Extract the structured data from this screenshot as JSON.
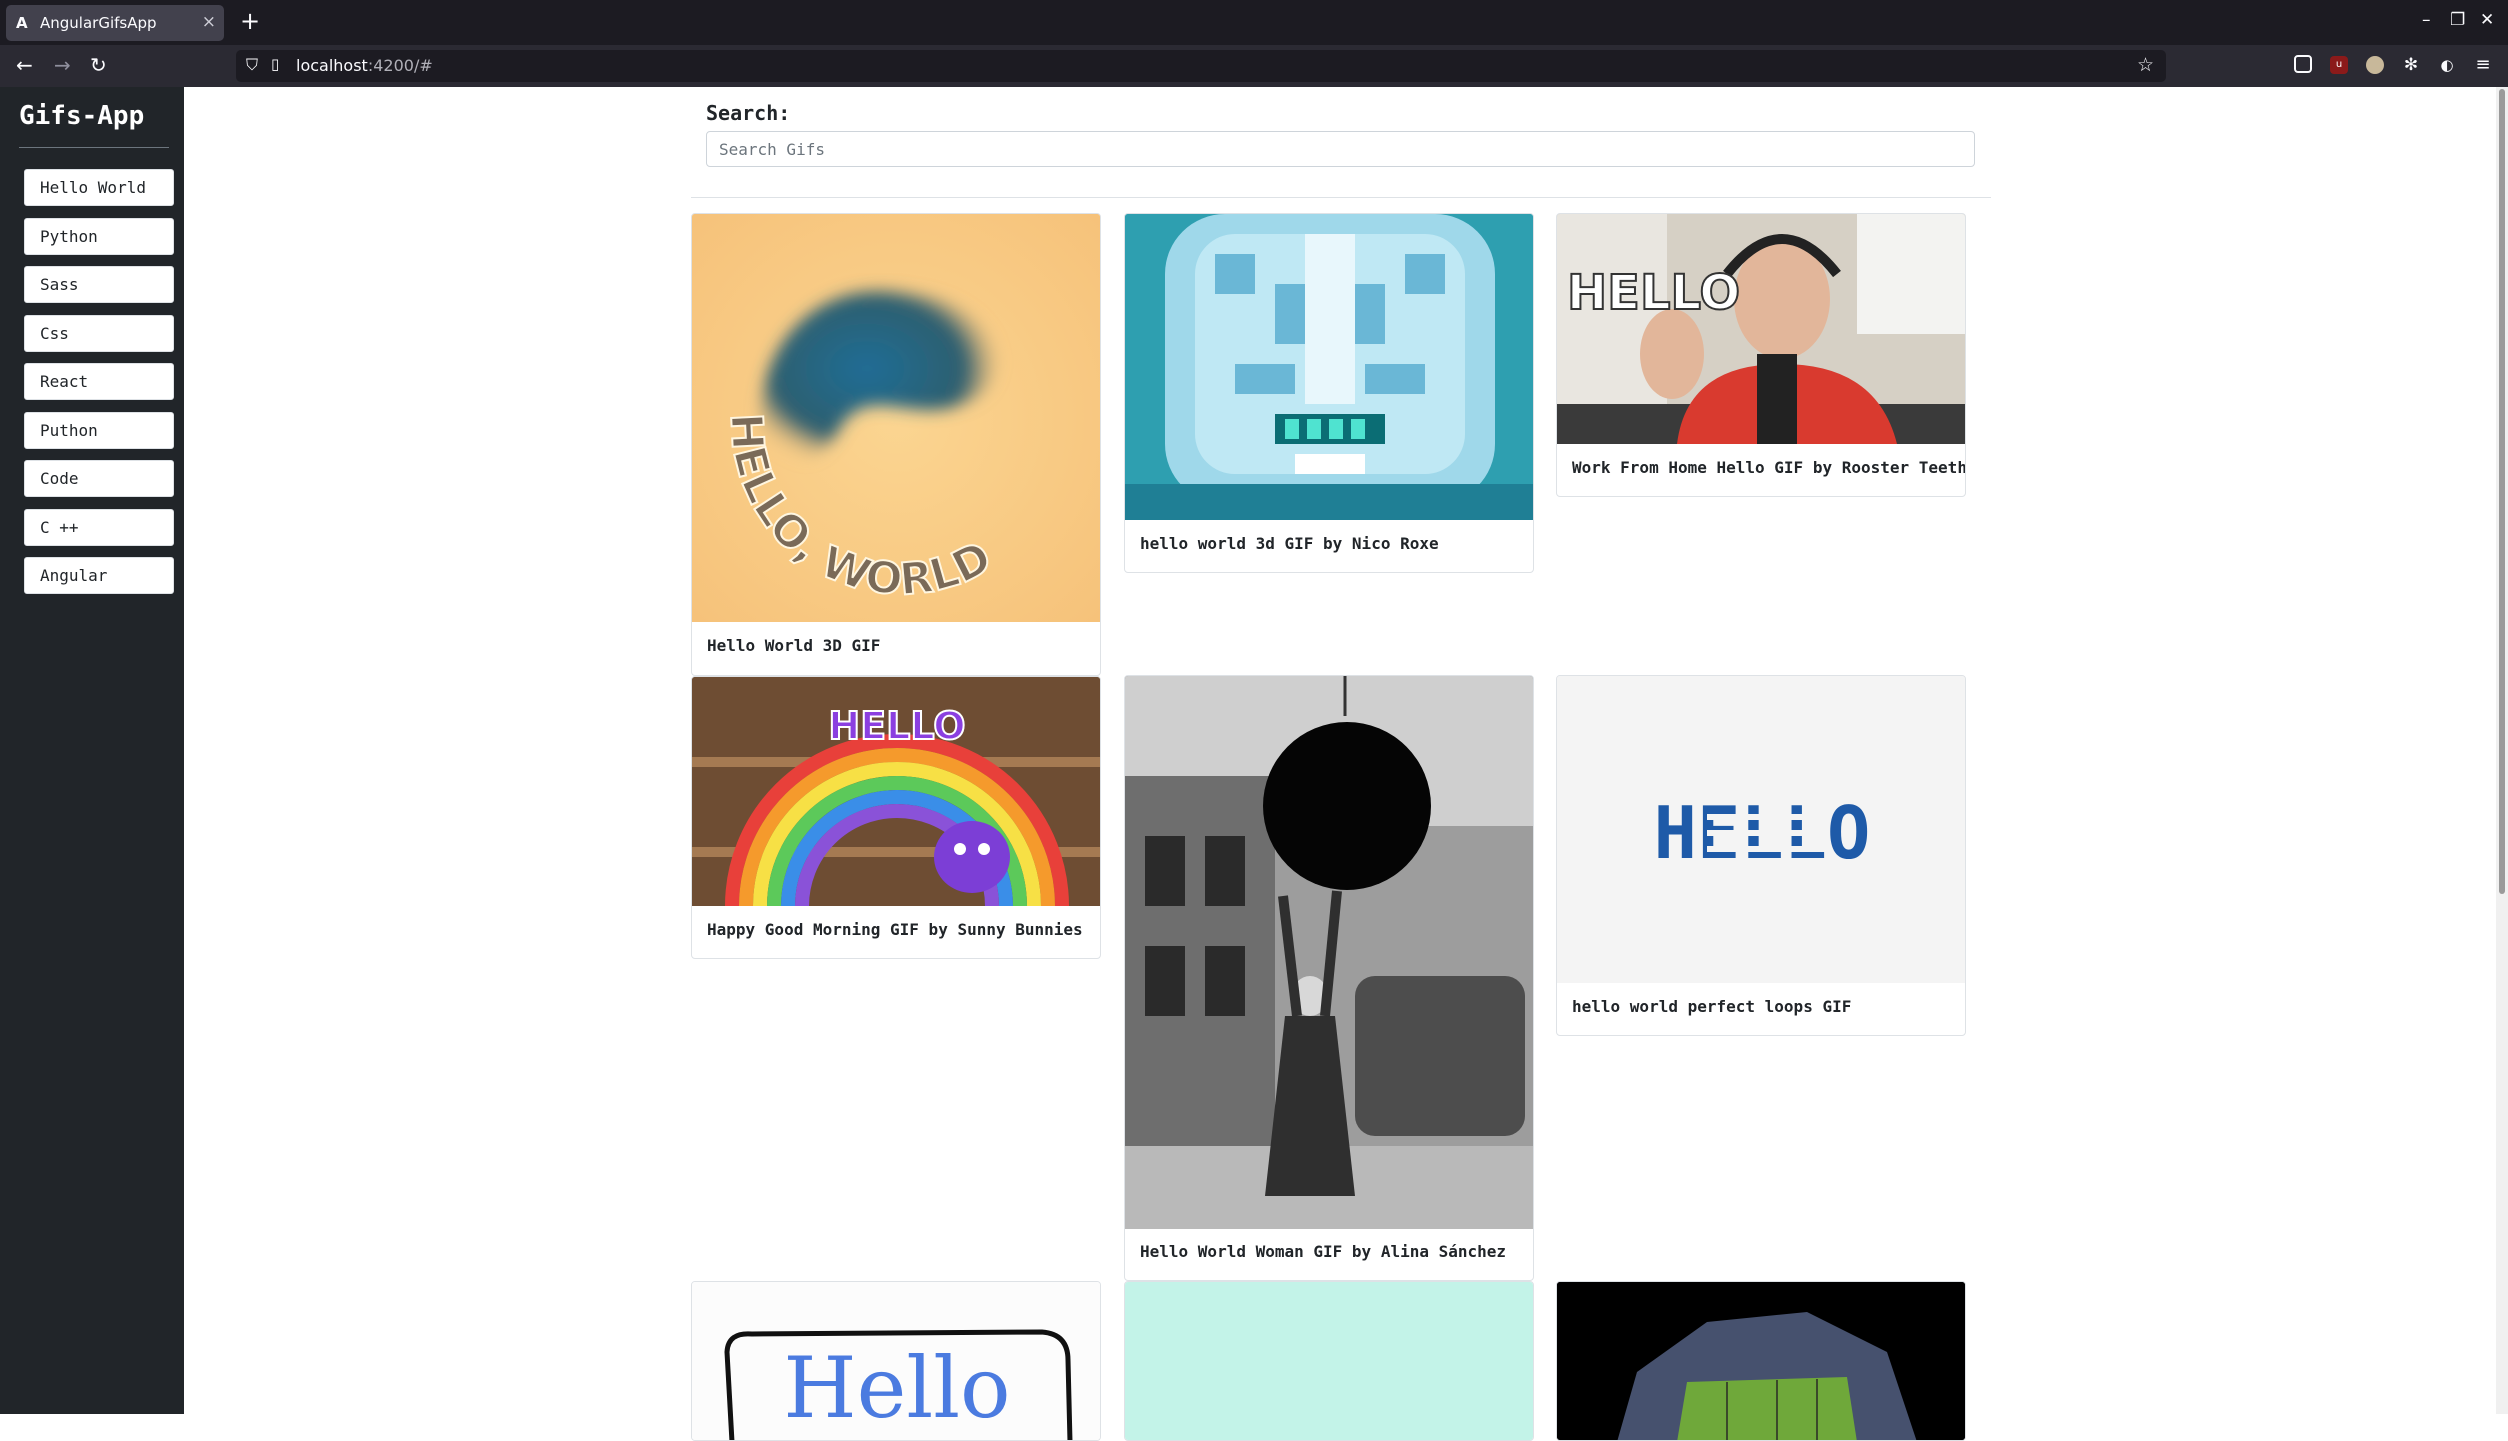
{
  "browser": {
    "tab_title": "AngularGifsApp",
    "tab_favicon": "A",
    "url_host": "localhost",
    "url_rest": ":4200/#"
  },
  "sidebar": {
    "brand": "Gifs-App",
    "items": [
      {
        "label": "Hello World"
      },
      {
        "label": "Python"
      },
      {
        "label": "Sass"
      },
      {
        "label": "Css"
      },
      {
        "label": "React"
      },
      {
        "label": "Puthon"
      },
      {
        "label": "Code"
      },
      {
        "label": "C ++"
      },
      {
        "label": "Angular"
      }
    ]
  },
  "search": {
    "label": "Search:",
    "placeholder": "Search Gifs",
    "value": ""
  },
  "gifs": [
    {
      "title": "Hello World 3D GIF",
      "image_text": "HELLO, WORLD"
    },
    {
      "title": "hello world 3d GIF by Nico Roxe"
    },
    {
      "title": "Work From Home Hello GIF by Rooster Teeth",
      "image_text": "HELLO"
    },
    {
      "title": "Happy Good Morning GIF by Sunny Bunnies",
      "image_text": "HELLO"
    },
    {
      "title": "Hello World Woman GIF by Alina Sánchez"
    },
    {
      "title": "hello world perfect loops GIF",
      "image_text": "HELLO"
    },
    {
      "title": "",
      "image_text": "Hello"
    },
    {
      "title": ""
    },
    {
      "title": ""
    }
  ],
  "colors": {
    "sidebar_bg": "#212529",
    "chrome_bg": "#1c1b22",
    "toolbar_bg": "#2b2a33",
    "card_border": "#dee2e6"
  }
}
